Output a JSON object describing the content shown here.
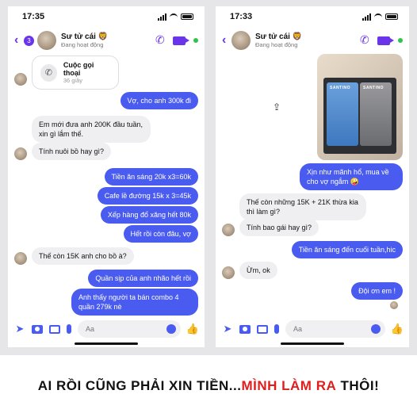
{
  "left": {
    "time": "17:35",
    "contact_name": "Sư tử cái 🦁",
    "contact_status": "Đang hoạt động",
    "badge": "3",
    "call_card": {
      "title": "Cuộc gọi thoại",
      "duration": "36 giây"
    },
    "messages": [
      {
        "side": "out",
        "text": "Vợ, cho anh 300k đi"
      },
      {
        "side": "in",
        "text": "Em mới đưa anh 200K đầu tuần, xin gì lắm thế."
      },
      {
        "side": "in",
        "text": "Tính nuôi bồ hay gì?"
      },
      {
        "side": "out",
        "text": "Tiền ăn sáng 20k x3=60k"
      },
      {
        "side": "out",
        "text": "Cafe lề đường 15k x 3=45k"
      },
      {
        "side": "out",
        "text": "Xếp hàng đổ xăng hết 80k"
      },
      {
        "side": "out",
        "text": "Hết rồi còn đâu, vợ"
      },
      {
        "side": "in",
        "text": "Thế còn 15K anh cho bồ à?"
      },
      {
        "side": "out",
        "text": "Quần sịp của anh nhão hết rồi"
      },
      {
        "side": "out",
        "text": "Anh thấy người ta bán combo 4 quần 279k nè"
      }
    ],
    "composer_placeholder": "Aa"
  },
  "right": {
    "time": "17:33",
    "contact_name": "Sư tử cái 🦁",
    "contact_status": "Đang hoạt động",
    "messages": [
      {
        "side": "out",
        "text": "Xịn như mãnh hổ, mua về cho vợ ngắm 🤪"
      },
      {
        "side": "in",
        "text": "Thế còn những 15K + 21K thừa kia thì làm gì?"
      },
      {
        "side": "in",
        "text": "Tính bao gái hay gì?"
      },
      {
        "side": "out",
        "text": "Tiền ăn sáng đến cuối tuần,hic"
      },
      {
        "side": "in",
        "text": "Ừm, ok"
      },
      {
        "side": "out",
        "text": "Đội ơn em !"
      }
    ],
    "photo_brand": "SANTINO",
    "composer_placeholder": "Aa"
  },
  "caption": {
    "part1": "AI RỒI CŨNG PHẢI XIN TIỀN...",
    "part2": "MÌNH LÀM RA",
    "part3": " THÔI!"
  },
  "colors": {
    "accent": "#6a35e8",
    "bubble_out": "#4a5cf0",
    "bubble_in": "#efeff1",
    "caption_red": "#e01d1d"
  }
}
